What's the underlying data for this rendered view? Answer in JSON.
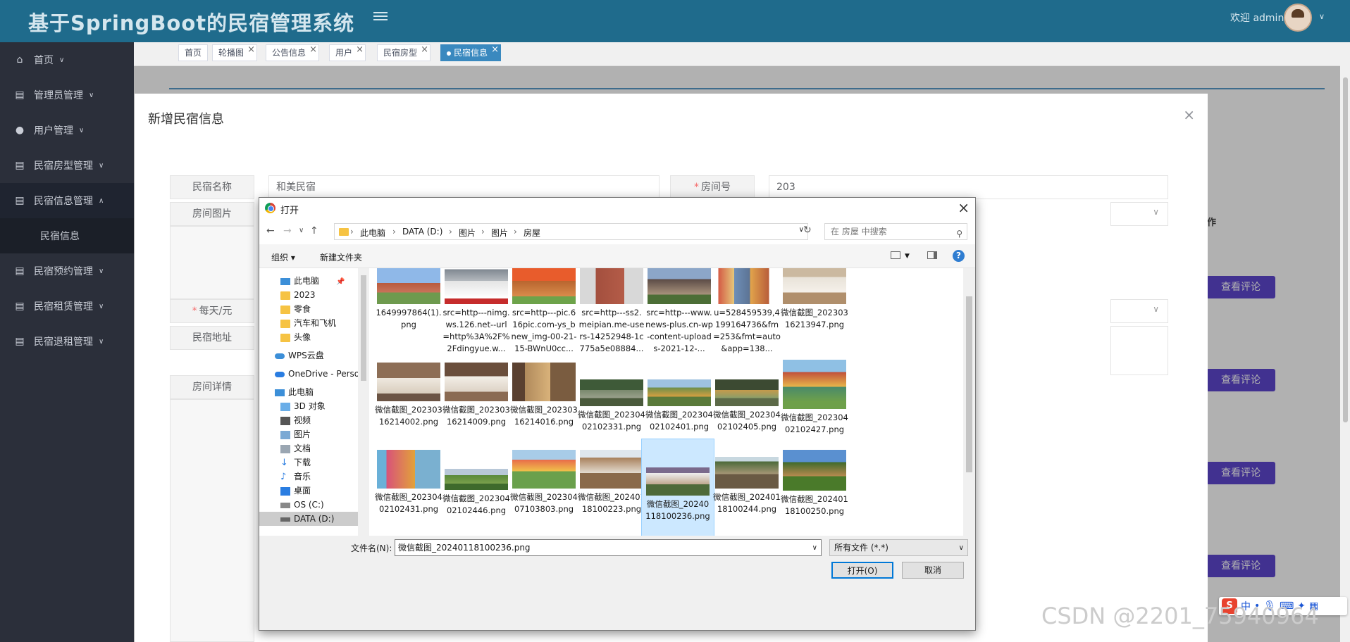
{
  "app": {
    "title": "基于SpringBoot的民宿管理系统",
    "welcome": "欢迎 admin"
  },
  "sidebar": {
    "items": [
      {
        "label": "首页",
        "icon": "home-icon"
      },
      {
        "label": "管理员管理",
        "icon": "table-icon"
      },
      {
        "label": "用户管理",
        "icon": "user-icon"
      },
      {
        "label": "民宿房型管理",
        "icon": "table-icon"
      },
      {
        "label": "民宿信息管理",
        "icon": "table-icon"
      },
      {
        "label": "民宿预约管理",
        "icon": "table-icon"
      },
      {
        "label": "民宿租赁管理",
        "icon": "table-icon"
      },
      {
        "label": "民宿退租管理",
        "icon": "table-icon"
      }
    ],
    "sub_item": "民宿信息"
  },
  "tags": [
    {
      "label": "首页",
      "closable": false
    },
    {
      "label": "轮播图",
      "closable": true
    },
    {
      "label": "公告信息",
      "closable": true
    },
    {
      "label": "用户",
      "closable": true
    },
    {
      "label": "民宿房型",
      "closable": true
    },
    {
      "label": "民宿信息",
      "closable": true,
      "active": true
    }
  ],
  "background": {
    "op_header": "操作",
    "comment_button": "查看评论"
  },
  "modal": {
    "title": "新增民宿信息",
    "fields": {
      "name_label": "民宿名称",
      "name_value": "和美民宿",
      "room_no_label": "房间号",
      "room_no_value": "203",
      "image_label": "房间图片",
      "price_label": "每天/元",
      "address_label": "民宿地址",
      "detail_label": "房间详情"
    }
  },
  "dialog": {
    "title": "打开",
    "breadcrumbs": [
      "此电脑",
      "DATA (D:)",
      "图片",
      "图片",
      "房屋"
    ],
    "search_placeholder": "在 房屋 中搜索",
    "organize": "组织 ▾",
    "new_folder": "新建文件夹",
    "nav": [
      "此电脑",
      "2023",
      "零食",
      "汽车和飞机",
      "头像",
      "WPS云盘",
      "OneDrive - Perso",
      "此电脑",
      "3D 对象",
      "视频",
      "图片",
      "文档",
      "下载",
      "音乐",
      "桌面",
      "OS (C:)",
      "DATA (D:)"
    ],
    "files": [
      "1649997864(1).png",
      "src=http---nimg.ws.126.net--url=http%3A%2F%2Fdingyue.w...",
      "src=http---pic.616pic.com-ys_bnew_img-00-21-15-BWnU0cc...",
      "src=http---ss2.meipian.me-users-14252948-1c775a5e08884...",
      "src=http---www.news-plus.cn-wp-content-uploads-2021-12-...",
      "u=528459539,4199164736&fm=253&fmt=auto&app=138...",
      "微信截图_20230316213947.png",
      "微信截图_20230316214002.png",
      "微信截图_20230316214009.png",
      "微信截图_20230316214016.png",
      "微信截图_20230402102331.png",
      "微信截图_20230402102401.png",
      "微信截图_20230402102405.png",
      "微信截图_20230402102427.png",
      "微信截图_20230402102431.png",
      "微信截图_20230402102446.png",
      "微信截图_20230407103803.png",
      "微信截图_20240118100223.png",
      "微信截图_20240118100236.png",
      "微信截图_20240118100244.png",
      "微信截图_20240118100250.png"
    ],
    "filename_label": "文件名(N):",
    "filename_value": "微信截图_20240118100236.png",
    "filetype": "所有文件 (*.*)",
    "open_button": "打开(O)",
    "cancel_button": "取消"
  },
  "watermark": "CSDN @2201_75940964",
  "ime": {
    "lang": "中"
  }
}
